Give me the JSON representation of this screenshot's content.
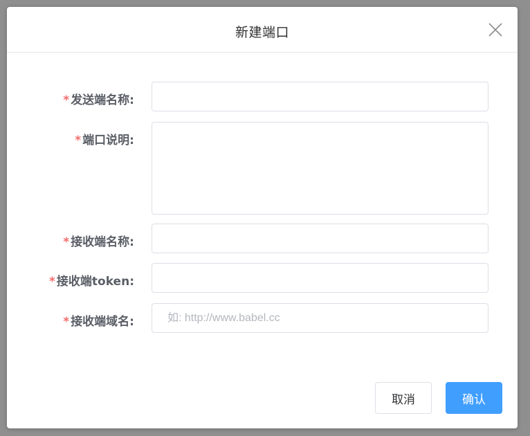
{
  "dialog": {
    "title": "新建端口",
    "close_icon": "close-icon"
  },
  "form": {
    "required_mark": "*",
    "fields": [
      {
        "label": "发送端名称:",
        "value": "",
        "placeholder": ""
      },
      {
        "label": "端口说明:",
        "value": "",
        "placeholder": ""
      },
      {
        "label": "接收端名称:",
        "value": "",
        "placeholder": ""
      },
      {
        "label": "接收端token:",
        "value": "",
        "placeholder": ""
      },
      {
        "label": "接收端域名:",
        "value": "",
        "placeholder": "如: http://www.babel.cc"
      }
    ]
  },
  "footer": {
    "cancel_label": "取消",
    "confirm_label": "确认"
  },
  "colors": {
    "primary": "#409eff",
    "required": "#f56c6c",
    "border": "#dcdfe6"
  }
}
